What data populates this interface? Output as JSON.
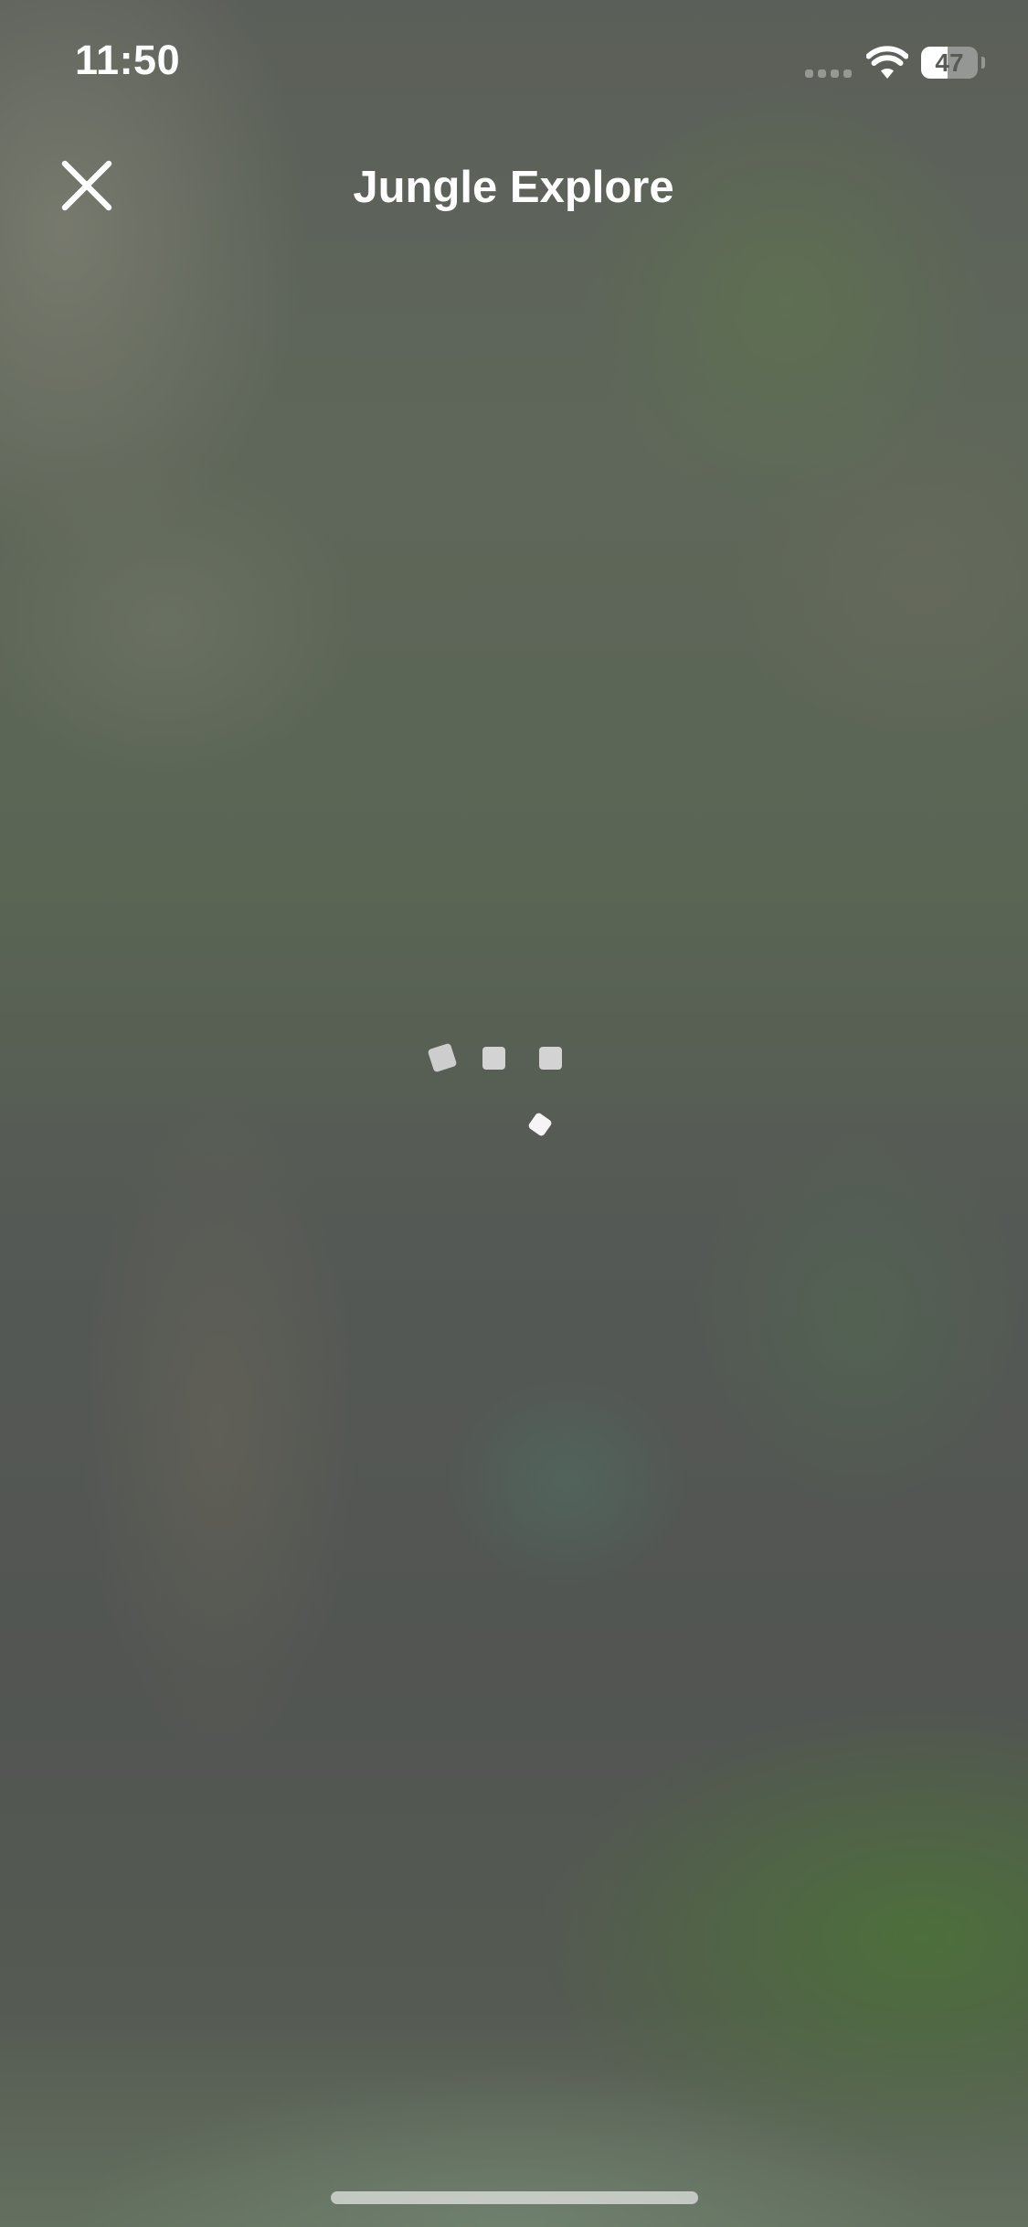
{
  "status_bar": {
    "time": "11:50",
    "battery_level": "47",
    "battery_fraction": 0.47,
    "signal_icon": "cellular-signal-icon",
    "wifi_icon": "wifi-icon",
    "battery_icon": "battery-icon"
  },
  "header": {
    "title": "Jungle Explore",
    "close_icon": "close-icon"
  },
  "loader": {
    "icon": "loading-spinner-icon",
    "color": "#d9d9d9"
  },
  "colors": {
    "background": "#575c57",
    "text": "#ffffff"
  }
}
